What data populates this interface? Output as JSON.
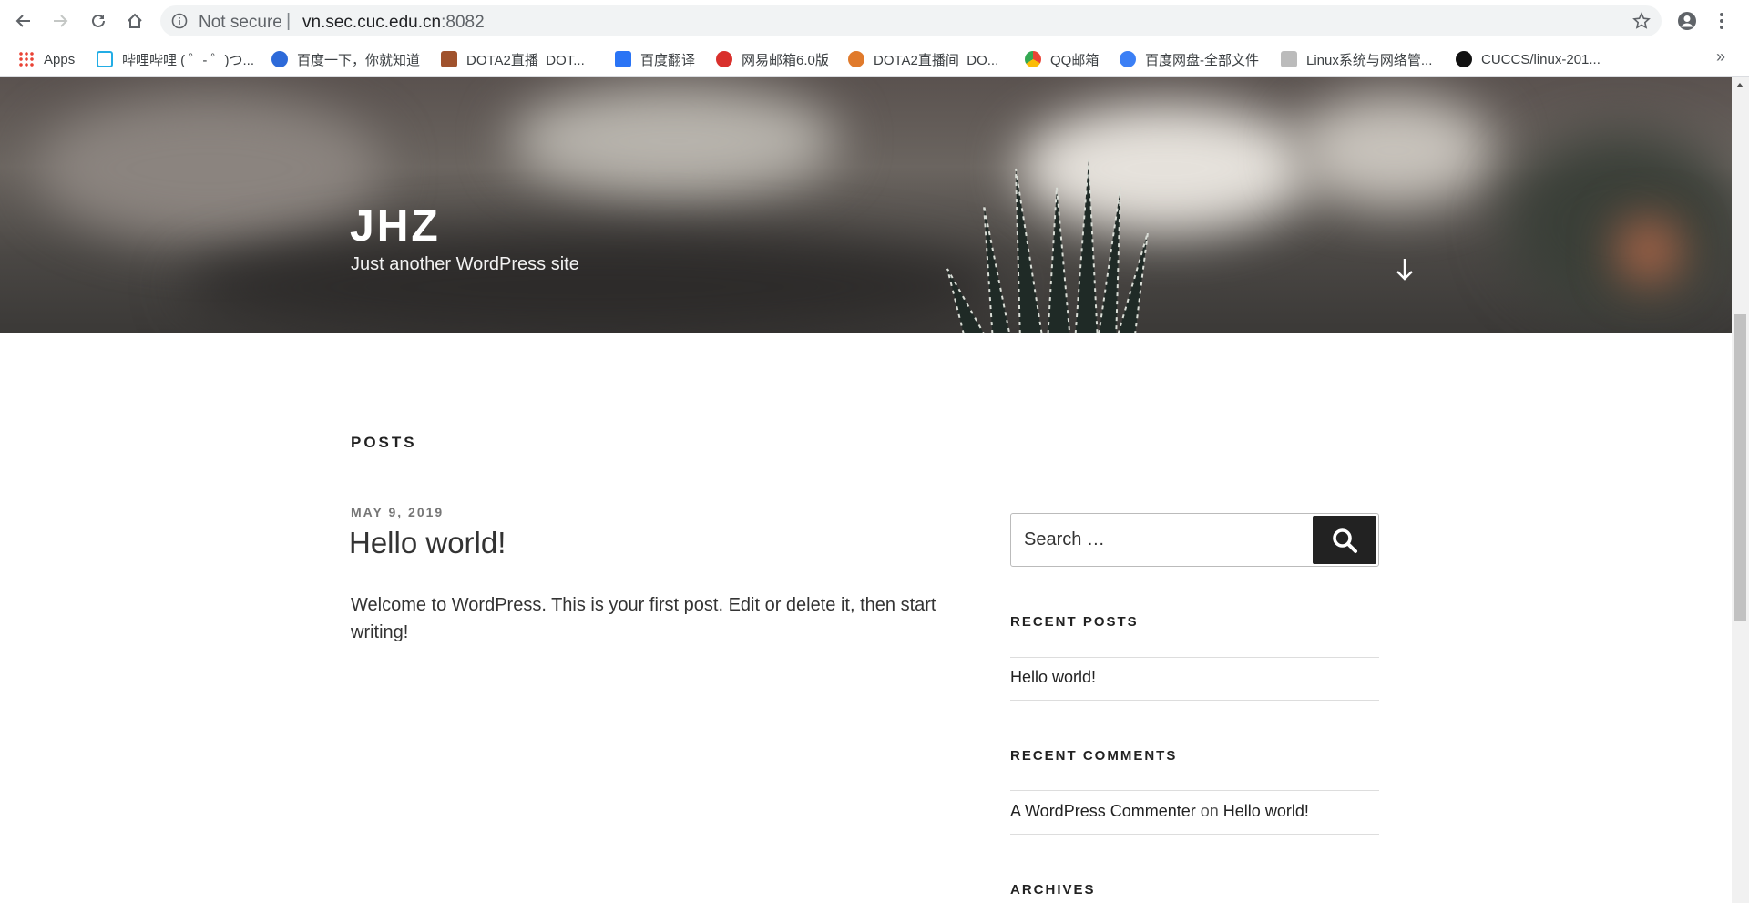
{
  "browser": {
    "security_label": "Not secure",
    "separator": "|",
    "url_host": "vn.sec.cuc.edu.cn",
    "url_port": ":8082"
  },
  "bookmarks": [
    {
      "label": "Apps",
      "icon": "apps-grid-icon",
      "color": "#4285f4"
    },
    {
      "label": "哔哩哔哩 ( ゜- ゜)つ...",
      "icon": "bilibili-icon",
      "color": "#23ade5"
    },
    {
      "label": "百度一下，你就知道",
      "icon": "baidu-icon",
      "color": "#2d6ad9"
    },
    {
      "label": "DOTA2直播_DOT...",
      "icon": "dota-icon",
      "color": "#a0522d"
    },
    {
      "label": "百度翻译",
      "icon": "baidu-translate-icon",
      "color": "#2a74f5"
    },
    {
      "label": "网易邮箱6.0版",
      "icon": "netease-mail-icon",
      "color": "#d9302c"
    },
    {
      "label": "DOTA2直播间_DO...",
      "icon": "dota-live-icon",
      "color": "#e07a2b"
    },
    {
      "label": "QQ邮箱",
      "icon": "qq-mail-icon",
      "color": "#34a853"
    },
    {
      "label": "百度网盘-全部文件",
      "icon": "baidu-pan-icon",
      "color": "#3b7ff5"
    },
    {
      "label": "Linux系统与网络管...",
      "icon": "linux-course-icon",
      "color": "#777777"
    },
    {
      "label": "CUCCS/linux-201...",
      "icon": "github-icon",
      "color": "#111111"
    }
  ],
  "site": {
    "title": "JHZ",
    "tagline": "Just another WordPress site"
  },
  "posts": {
    "heading": "POSTS",
    "items": [
      {
        "date": "MAY 9, 2019",
        "title": "Hello world!",
        "excerpt": "Welcome to WordPress. This is your first post. Edit or delete it, then start writing!"
      }
    ]
  },
  "sidebar": {
    "search_placeholder": "Search …",
    "recent_posts_title": "RECENT POSTS",
    "recent_posts": [
      "Hello world!"
    ],
    "recent_comments_title": "RECENT COMMENTS",
    "comment_author": "A WordPress Commenter",
    "comment_on": "on",
    "comment_post": "Hello world!",
    "archives_title": "ARCHIVES"
  },
  "colors": {
    "hero_text": "#ffffff",
    "search_button": "#222222",
    "link": "#222222"
  }
}
